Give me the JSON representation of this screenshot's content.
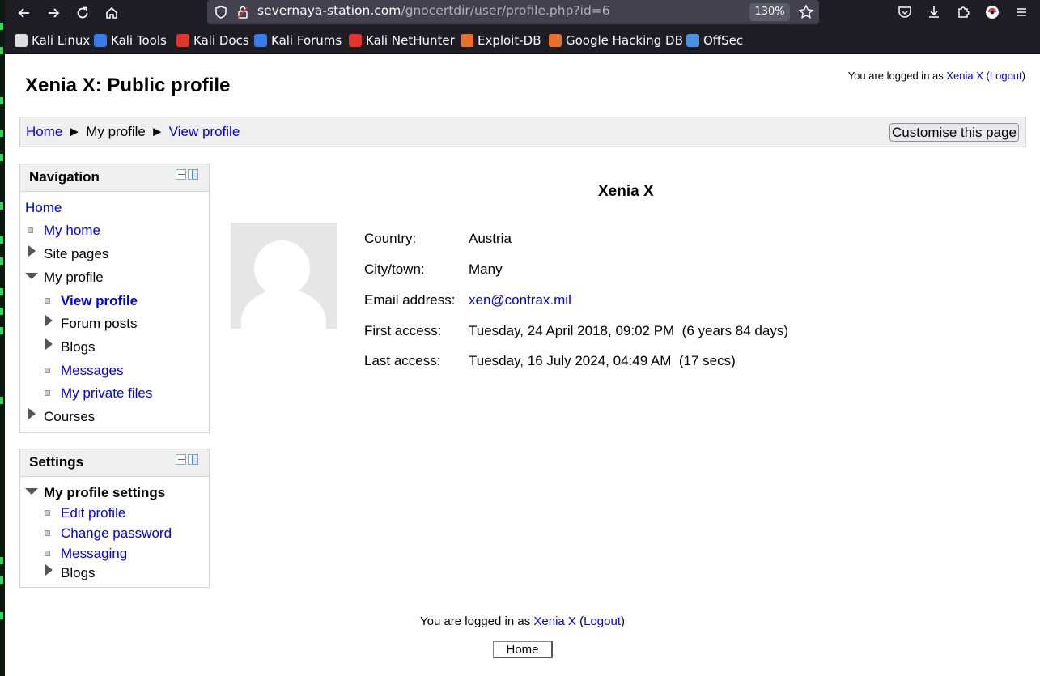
{
  "browser": {
    "url_host": "severnaya-station.com",
    "url_path": "/gnocertdir/user/profile.php?id=6",
    "zoom": "130%",
    "bookmarks": [
      {
        "label": "Kali Linux",
        "icon": "kali-dragon-icon",
        "color": "#dddddd"
      },
      {
        "label": "Kali Tools",
        "icon": "kali-tools-icon",
        "color": "#3b7be8"
      },
      {
        "label": "Kali Docs",
        "icon": "kali-docs-icon",
        "color": "#e0342c"
      },
      {
        "label": "Kali Forums",
        "icon": "kali-forums-icon",
        "color": "#3b7be8"
      },
      {
        "label": "Kali NetHunter",
        "icon": "nethunter-icon",
        "color": "#e0342c"
      },
      {
        "label": "Exploit-DB",
        "icon": "exploit-db-icon",
        "color": "#e8702a"
      },
      {
        "label": "Google Hacking DB",
        "icon": "ghdb-icon",
        "color": "#e8702a"
      },
      {
        "label": "OffSec",
        "icon": "offsec-icon",
        "color": "#4a8fe0"
      }
    ]
  },
  "page": {
    "title": "Xenia X: Public profile",
    "login_prefix": "You are logged in as",
    "user_name": "Xenia X",
    "logout_label": "Logout",
    "breadcrumb": {
      "home": "Home",
      "sep": "►",
      "my_profile": "My profile",
      "view_profile": "View profile"
    },
    "customise_label": "Customise this page"
  },
  "navigation": {
    "title": "Navigation",
    "home": "Home",
    "my_home": "My home",
    "site_pages": "Site pages",
    "my_profile": "My profile",
    "view_profile": "View profile",
    "forum_posts": "Forum posts",
    "blogs": "Blogs",
    "messages": "Messages",
    "my_private_files": "My private files",
    "courses": "Courses"
  },
  "settings": {
    "title": "Settings",
    "my_profile_settings": "My profile settings",
    "edit_profile": "Edit profile",
    "change_password": "Change password",
    "messaging": "Messaging",
    "blogs": "Blogs"
  },
  "profile": {
    "name": "Xenia X",
    "fields": [
      {
        "label": "Country:",
        "value": "Austria"
      },
      {
        "label": "City/town:",
        "value": "Many"
      },
      {
        "label": "Email address:",
        "value": "xen@contrax.mil"
      },
      {
        "label": "First access:",
        "value": "Tuesday, 24 April 2018, 09:02 PM  (6 years 84 days)"
      },
      {
        "label": "Last access:",
        "value": "Tuesday, 16 July 2024, 04:49 AM  (17 secs)"
      }
    ]
  },
  "footer": {
    "home_button": "Home"
  },
  "colors": {
    "link": "#0000dd",
    "chrome_bg": "#1f1e25",
    "urlbar_bg": "#42414d",
    "block_header_bg": "#efefef"
  }
}
